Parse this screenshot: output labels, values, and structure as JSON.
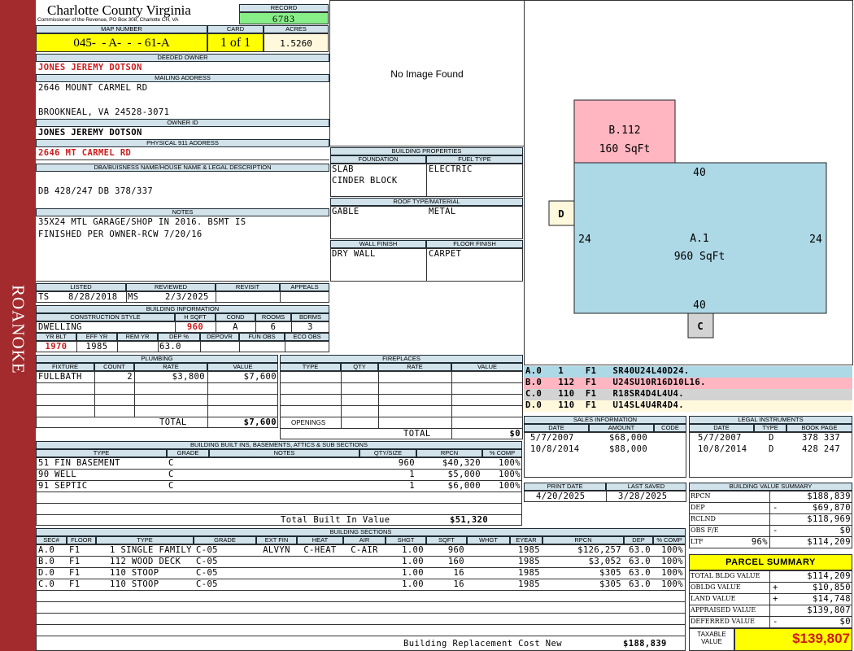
{
  "sidebar": {
    "text": "ROANOKE",
    "color": "#a32a2d"
  },
  "header": {
    "county": "Charlotte County Virginia",
    "subtitle": "Commissioner of the Revenue, PO Box 308, Charlotte CH, VA",
    "record_label": "RECORD",
    "record": "6783",
    "map_label": "MAP NUMBER",
    "map_number": "045-  - A-  -  - 61-A",
    "card_label": "CARD",
    "card": "1 of 1",
    "acres_label": "ACRES",
    "acres": "1.5260"
  },
  "owner": {
    "deeded_label": "DEEDED OWNER",
    "deeded": "JONES JEREMY DOTSON",
    "mailing_label": "MAILING ADDRESS",
    "mail1": "2646 MOUNT CARMEL RD",
    "mail2": "",
    "mail3": "BROOKNEAL, VA 24528-3071",
    "id_label": "OWNER ID",
    "owner_id": "JONES JEREMY DOTSON",
    "phys_label": "PHYSICAL 911 ADDRESS",
    "physical": "2646 MT CARMEL RD"
  },
  "legal": {
    "label": "DBA/BUISNESS NAME/HOUSE NAME & LEGAL DESCRIPTION",
    "text": "DB 428/247 DB 378/337"
  },
  "notes": {
    "label": "NOTES",
    "line1": "35X24 MTL GARAGE/SHOP IN 2016. BSMT IS",
    "line2": "FINISHED PER OWNER-RCW 7/20/16"
  },
  "image": {
    "text": "No Image Found"
  },
  "props": {
    "label": "BUILDING PROPERTIES",
    "foundation_label": "FOUNDATION",
    "fuel_label": "FUEL TYPE",
    "foundation1": "SLAB",
    "foundation2": "CINDER BLOCK",
    "fuel": "ELECTRIC",
    "roof_label": "ROOF TYPE/MATERIAL",
    "roof_type": "GABLE",
    "roof_mat": "METAL",
    "wall_label": "WALL FINISH",
    "floor_label": "FLOOR FINISH",
    "wall": "DRY WALL",
    "floor": "CARPET"
  },
  "review": {
    "listed_label": "LISTED",
    "reviewed_label": "REVIEWED",
    "revisit_label": "REVISIT",
    "appeals_label": "APPEALS",
    "listed_by": "TS",
    "listed_date": "8/28/2018",
    "reviewed_by": "MS",
    "reviewed_date": "2/3/2025"
  },
  "bldg": {
    "label": "BUILDING INFORMATION",
    "style_label": "CONSTRUCTION STYLE",
    "hsqft_label": "H SQFT",
    "cond_label": "COND",
    "rooms_label": "ROOMS",
    "bdrms_label": "BDRMS",
    "style": "DWELLING",
    "hsqft": "960",
    "cond": "A",
    "rooms": "6",
    "bdrms": "3",
    "yrblt_label": "YR BLT",
    "effyr_label": "EFF YR",
    "remyr_label": "REM YR",
    "dep_label": "DEP %",
    "depovr_label": "DEPOVR",
    "funobs_label": "FUN OBS",
    "ecoobs_label": "ECO OBS",
    "yrblt": "1970",
    "effyr": "1985",
    "dep": "63.0"
  },
  "plumbing": {
    "label": "PLUMBING",
    "h_fixture": "FIXTURE",
    "h_count": "COUNT",
    "h_rate": "RATE",
    "h_value": "VALUE",
    "fixture": "FULLBATH",
    "count": "2",
    "rate": "$3,800",
    "value": "$7,600",
    "total_label": "TOTAL",
    "total": "$7,600"
  },
  "fireplaces": {
    "label": "FIREPLACES",
    "h_type": "TYPE",
    "h_qty": "QTY",
    "h_rate": "RATE",
    "h_value": "VALUE",
    "openings": "OPENINGS",
    "total_label": "TOTAL",
    "total": "$0"
  },
  "builtins": {
    "label": "BUILDING BUILT INS, BASEMENTS, ATTICS & SUB SECTIONS",
    "h_type": "TYPE",
    "h_grade": "GRADE",
    "h_notes": "NOTES",
    "h_qty": "QTY/SIZE",
    "h_rpcn": "RPCN",
    "h_comp": "% COMP",
    "rows": [
      {
        "type": "51 FIN BASEMENT",
        "grade": "C",
        "qty": "960",
        "rpcn": "$40,320",
        "comp": "100%"
      },
      {
        "type": "90 WELL",
        "grade": "C",
        "qty": "1",
        "rpcn": "$5,000",
        "comp": "100%"
      },
      {
        "type": "91 SEPTIC",
        "grade": "C",
        "qty": "1",
        "rpcn": "$6,000",
        "comp": "100%"
      }
    ],
    "total_label": "Total Built In Value",
    "total": "$51,320"
  },
  "sections": {
    "label": "BUILDING SECTIONS",
    "headers": [
      "SEC#",
      "FLOOR",
      "TYPE",
      "GRADE",
      "EXT FIN",
      "HEAT",
      "AIR",
      "SHGT",
      "SQFT",
      "WHGT",
      "EYEAR",
      "RPCN",
      "DEP",
      "% COMP"
    ],
    "rows": [
      [
        "A.0",
        "F1",
        "1 SINGLE FAMILY",
        "C-05",
        "ALVYN",
        "C-HEAT",
        "C-AIR",
        "1.00",
        "960",
        "",
        "1985",
        "$126,257",
        "63.0",
        "100%"
      ],
      [
        "B.0",
        "F1",
        "112 WOOD DECK",
        "C-05",
        "",
        "",
        "",
        "1.00",
        "160",
        "",
        "1985",
        "$3,052",
        "63.0",
        "100%"
      ],
      [
        "D.0",
        "F1",
        "110 STOOP",
        "C-05",
        "",
        "",
        "",
        "1.00",
        "16",
        "",
        "1985",
        "$305",
        "63.0",
        "100%"
      ],
      [
        "C.0",
        "F1",
        "110 STOOP",
        "C-05",
        "",
        "",
        "",
        "1.00",
        "16",
        "",
        "1985",
        "$305",
        "63.0",
        "100%"
      ]
    ],
    "footer_label": "Building Replacement Cost New",
    "footer": "$188,839"
  },
  "sketch": {
    "b_name": "B.112",
    "b_area": "160 SqFt",
    "a_name": "A.1",
    "a_area": "960 SqFt",
    "top": "40",
    "bottom": "40",
    "left": "24",
    "right": "24",
    "d": "D",
    "c": "C"
  },
  "legend": [
    {
      "text": "A.0   1    F1   SR40U24L40D24.",
      "color": "#add8e6"
    },
    {
      "text": "B.0   112  F1   U24SU10R16D10L16.",
      "color": "#ffb6c1"
    },
    {
      "text": "C.0   110  F1   R18SR4D4L4U4.",
      "color": "#d3d3d3"
    },
    {
      "text": "D.0   110  F1   U14SL4U4R4D4.",
      "color": "#fff8dc"
    }
  ],
  "sales": {
    "label": "SALES INFORMATION",
    "h_date": "DATE",
    "h_amount": "AMOUNT",
    "h_code": "CODE",
    "rows": [
      {
        "date": "5/7/2007",
        "amount": "$68,000"
      },
      {
        "date": "10/8/2014",
        "amount": "$88,000"
      }
    ]
  },
  "instruments": {
    "label": "LEGAL INSTRUMENTS",
    "h_date": "DATE",
    "h_type": "TYPE",
    "h_book": "BOOK PAGE",
    "rows": [
      {
        "date": "5/7/2007",
        "type": "D",
        "book": "378 337"
      },
      {
        "date": "10/8/2014",
        "type": "D",
        "book": "428 247"
      }
    ]
  },
  "print": {
    "print_label": "PRINT DATE",
    "saved_label": "LAST SAVED",
    "print_date": "4/20/2025",
    "saved": "3/28/2025"
  },
  "valsum": {
    "label": "BUILDING VALUE SUMMARY",
    "rows": [
      {
        "k": "RPCN",
        "s": "",
        "v": "$188,839"
      },
      {
        "k": "DEP",
        "s": "-",
        "v": "$69,870"
      },
      {
        "k": "RCLND",
        "s": "",
        "v": "$118,969"
      },
      {
        "k": "OBS F/E",
        "s": "-",
        "v": "$0"
      },
      {
        "k": "LTF",
        "p": "96%",
        "s": "",
        "v": "$114,209"
      }
    ]
  },
  "parcel": {
    "label": "PARCEL SUMMARY",
    "rows": [
      {
        "k": "TOTAL BLDG VALUE",
        "s": "",
        "v": "$114,209"
      },
      {
        "k": "OBLDG VALUE",
        "s": "+",
        "v": "$10,850"
      },
      {
        "k": "LAND VALUE",
        "s": "+",
        "v": "$14,748"
      },
      {
        "k": "APPRAISED VALUE",
        "s": "",
        "v": "$139,807"
      },
      {
        "k": "DEFERRED VALUE",
        "s": "-",
        "v": "$0"
      }
    ],
    "taxable_label": "TAXABLE VALUE",
    "taxable": "$139,807"
  }
}
